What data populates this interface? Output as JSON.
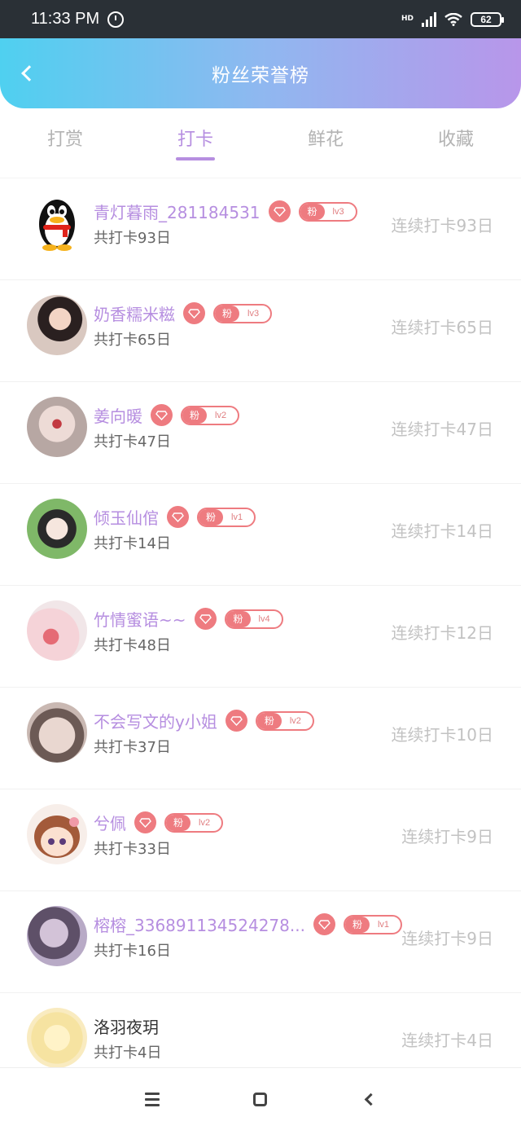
{
  "status": {
    "time": "11:33 PM",
    "network": "HD",
    "battery": "62"
  },
  "header": {
    "title": "粉丝荣誉榜"
  },
  "tabs": [
    {
      "label": "打赏",
      "active": false
    },
    {
      "label": "打卡",
      "active": true
    },
    {
      "label": "鲜花",
      "active": false
    },
    {
      "label": "收藏",
      "active": false
    }
  ],
  "badge_label": "粉",
  "rows": [
    {
      "name": "青灯暮雨_281184531",
      "level": "lv3",
      "total": "共打卡93日",
      "streak": "连续打卡93日",
      "avatar": "qq-penguin-avatar",
      "badge": true
    },
    {
      "name": "奶香糯米糍",
      "level": "lv3",
      "total": "共打卡65日",
      "streak": "连续打卡65日",
      "avatar": "user-photo-avatar",
      "badge": true
    },
    {
      "name": "姜向暖",
      "level": "lv2",
      "total": "共打卡47日",
      "streak": "连续打卡47日",
      "avatar": "user-photo-avatar",
      "badge": true
    },
    {
      "name": "倾玉仙倌",
      "level": "lv1",
      "total": "共打卡14日",
      "streak": "连续打卡14日",
      "avatar": "user-photo-avatar",
      "badge": true
    },
    {
      "name": "竹情蜜语~~",
      "level": "lv4",
      "total": "共打卡48日",
      "streak": "连续打卡12日",
      "avatar": "user-photo-avatar",
      "badge": true
    },
    {
      "name": "不会写文的y小姐",
      "level": "lv2",
      "total": "共打卡37日",
      "streak": "连续打卡10日",
      "avatar": "user-photo-avatar",
      "badge": true
    },
    {
      "name": "兮佩",
      "level": "lv2",
      "total": "共打卡33日",
      "streak": "连续打卡9日",
      "avatar": "cartoon-girl-avatar",
      "badge": true
    },
    {
      "name": "榕榕_336891134524278...",
      "level": "lv1",
      "total": "共打卡16日",
      "streak": "连续打卡9日",
      "avatar": "user-photo-avatar",
      "badge": true
    },
    {
      "name": "洛羽夜玥",
      "level": "",
      "total": "共打卡4日",
      "streak": "连续打卡4日",
      "avatar": "anime-avatar",
      "badge": false
    }
  ],
  "colors": {
    "accent": "#b68ee0",
    "badge": "#ee7b80",
    "header_start": "#4fd0f0",
    "header_end": "#b896ea"
  },
  "navbar": {
    "icons": [
      "menu-icon",
      "home-icon",
      "back-icon"
    ]
  }
}
